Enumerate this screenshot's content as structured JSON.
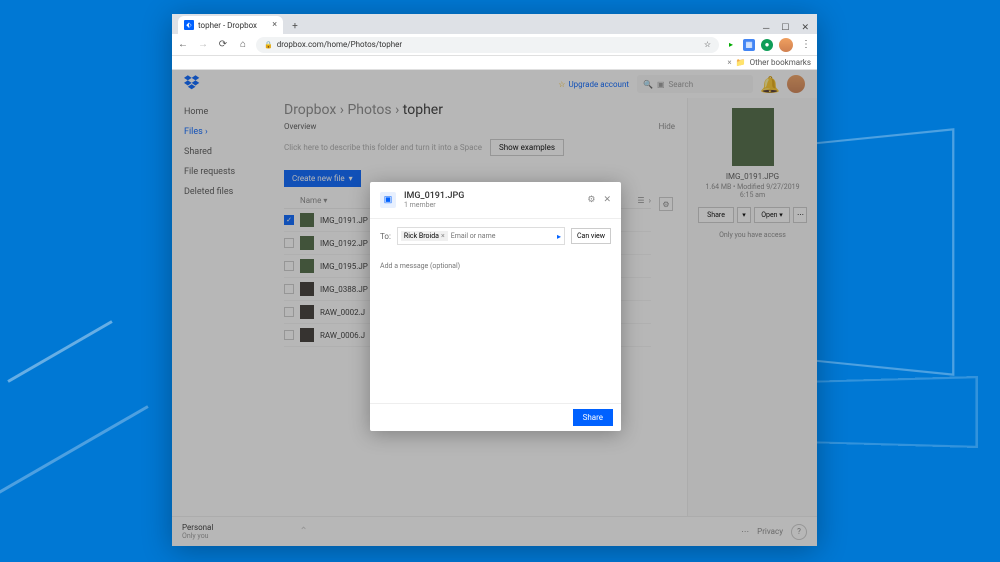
{
  "browser": {
    "tab_title": "topher - Dropbox",
    "url": "dropbox.com/home/Photos/topher",
    "bookmarks_label": "Other bookmarks"
  },
  "header": {
    "upgrade": "Upgrade account",
    "search_placeholder": "Search"
  },
  "sidebar": {
    "items": [
      "Home",
      "Files",
      "Shared",
      "File requests",
      "Deleted files"
    ]
  },
  "breadcrumb": {
    "seg1": "Dropbox",
    "seg2": "Photos",
    "current": "topher"
  },
  "tabs": {
    "overview": "Overview",
    "hide": "Hide"
  },
  "desc": {
    "placeholder": "Click here to describe this folder and turn it into a Space",
    "show_examples": "Show examples"
  },
  "toolbar": {
    "create": "Create new file"
  },
  "list": {
    "name_header": "Name",
    "files": [
      {
        "name": "IMG_0191.JP",
        "checked": true,
        "dark": false
      },
      {
        "name": "IMG_0192.JP",
        "checked": false,
        "dark": false
      },
      {
        "name": "IMG_0195.JP",
        "checked": false,
        "dark": false
      },
      {
        "name": "IMG_0388.JP",
        "checked": false,
        "dark": true
      },
      {
        "name": "RAW_0002.J",
        "checked": false,
        "dark": true
      },
      {
        "name": "RAW_0006.J",
        "checked": false,
        "dark": true
      }
    ]
  },
  "detail": {
    "filename": "IMG_0191.JPG",
    "meta": "1.64 MB • Modified 9/27/2019 6:15 am",
    "share": "Share",
    "open": "Open",
    "access": "Only you have access"
  },
  "footer": {
    "plan": "Personal",
    "sub": "Only you",
    "privacy": "Privacy"
  },
  "modal": {
    "title": "IMG_0191.JPG",
    "subtitle": "1 member",
    "to_label": "To:",
    "chip": "Rick Broida",
    "input_placeholder": "Email or name",
    "permission": "Can view",
    "message_placeholder": "Add a message (optional)",
    "share": "Share"
  }
}
